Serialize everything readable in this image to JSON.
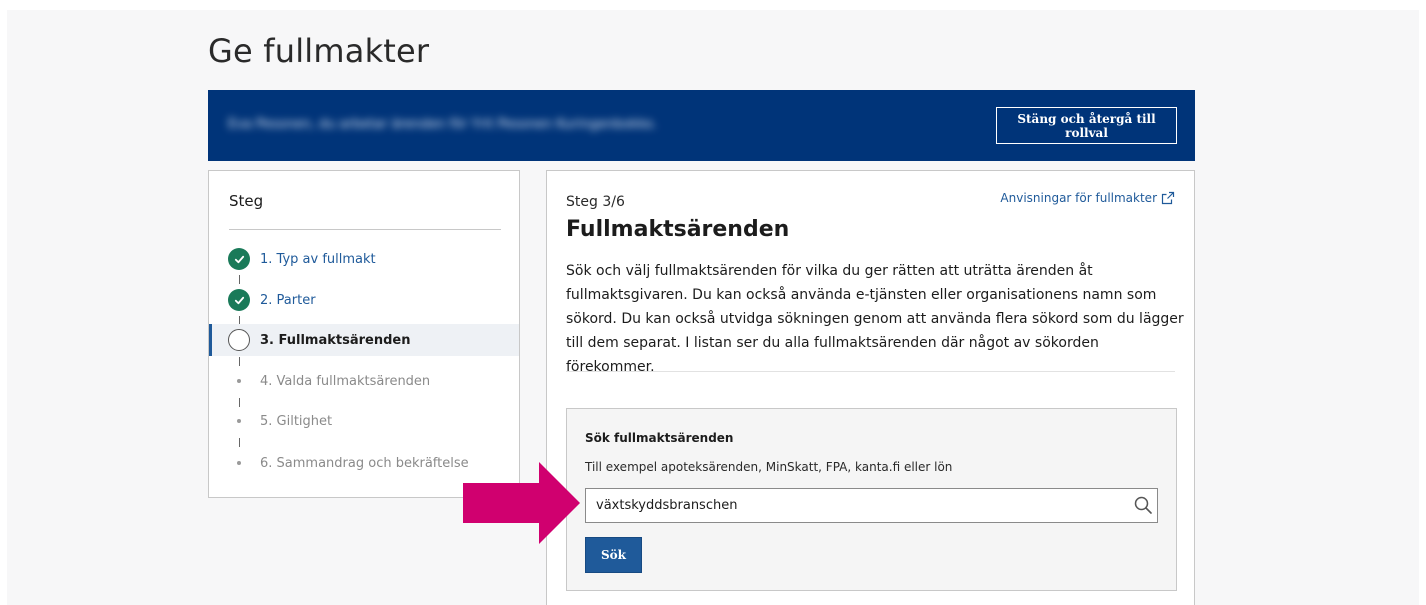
{
  "page": {
    "title": "Ge fullmakter"
  },
  "banner": {
    "blurred_text": "Eva Pesonen, du arbetar ärenden för Yrit Pesonen Kuringenbokko.",
    "close_label": "Stäng och återgå till rollval"
  },
  "steps": {
    "title": "Steg",
    "items": [
      {
        "label": "1. Typ av fullmakt",
        "state": "done"
      },
      {
        "label": "2. Parter",
        "state": "done"
      },
      {
        "label": "3. Fullmaktsärenden",
        "state": "current"
      },
      {
        "label": "4. Valda fullmaktsärenden",
        "state": "pending"
      },
      {
        "label": "5. Giltighet",
        "state": "pending"
      },
      {
        "label": "6. Sammandrag och bekräftelse",
        "state": "pending"
      }
    ]
  },
  "main": {
    "step_counter": "Steg 3/6",
    "guidance_link": "Anvisningar för fullmakter",
    "heading": "Fullmaktsärenden",
    "description": "Sök och välj fullmaktsärenden för vilka du ger rätten att uträtta ärenden åt fullmaktsgivaren. Du kan också använda e-tjänsten eller organisationens namn som sökord. Du kan också utvidga sökningen genom att använda flera sökord som du lägger till dem separat. I listan ser du alla fullmaktsärenden där något av sökorden förekommer.",
    "search": {
      "label": "Sök fullmaktsärenden",
      "hint": "Till exempel apoteksärenden, MinSkatt, FPA, kanta.fi eller lön",
      "value": "växtskyddsbranschen",
      "button_label": "Sök"
    }
  },
  "colors": {
    "banner": "#003479",
    "accent": "#1f5a9a",
    "done": "#1a7a59",
    "arrow": "#d0006f"
  },
  "icons": {
    "done": "check-icon",
    "external": "external-link-icon",
    "search": "search-icon",
    "annotation": "arrow-right-icon"
  }
}
